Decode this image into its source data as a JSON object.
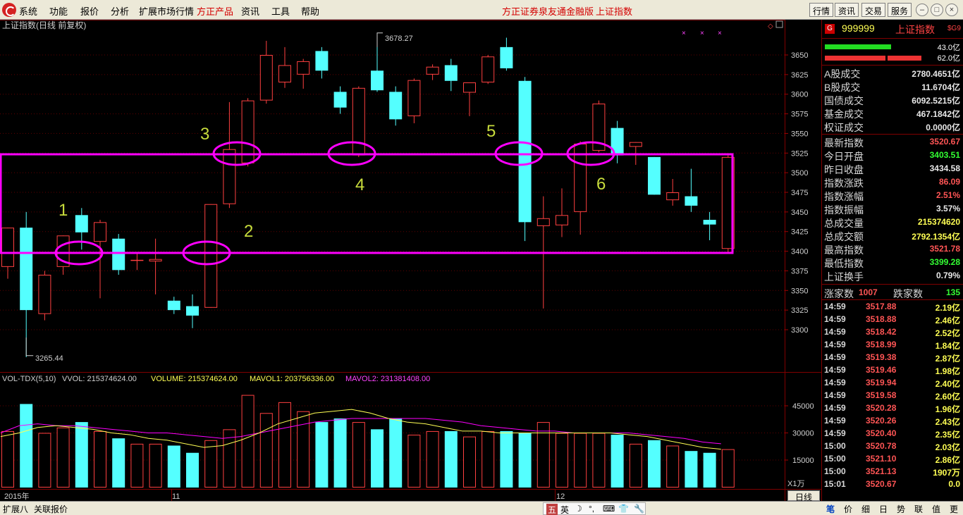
{
  "menu": {
    "items": [
      "系统",
      "功能",
      "报价",
      "分析",
      "扩展市场行情",
      "方正产品",
      "资讯",
      "工具",
      "帮助"
    ],
    "brand": "方正证券泉友通金融版",
    "brand_index": "上证指数",
    "right_buttons": [
      "行情",
      "资讯",
      "交易",
      "服务"
    ]
  },
  "chart": {
    "title": "上证指数(日线 前复权)",
    "price_ticks": [
      "3650",
      "3625",
      "3600",
      "3575",
      "3550",
      "3525",
      "3500",
      "3475",
      "3450",
      "3425",
      "3400",
      "3375",
      "3350",
      "3325",
      "3300"
    ],
    "vol_ticks": [
      "45000",
      "30000",
      "15000"
    ],
    "vol_unit": "X1万",
    "high_label": "3678.27",
    "low_label": "3265.44",
    "date_labels": [
      "2015年",
      "11",
      "12"
    ],
    "annotations": [
      "1",
      "2",
      "3",
      "4",
      "5",
      "6"
    ],
    "volume_header": {
      "name": "VOL-TDX(5,10)",
      "vvol": "VVOL: 215374624.00",
      "volume": "VOLUME: 215374624.00",
      "mavol1": "MAVOL1: 203756336.00",
      "mavol2": "MAVOL2: 231381408.00"
    },
    "period": "日线"
  },
  "chart_data": {
    "type": "candlestick",
    "title": "上证指数(日线 前复权)",
    "ylim": [
      3265,
      3690
    ],
    "candles": [
      {
        "o": 3380,
        "h": 3405,
        "c": 3430,
        "l": 3365
      },
      {
        "o": 3430,
        "h": 3450,
        "c": 3325,
        "l": 3265
      },
      {
        "o": 3320,
        "h": 3375,
        "c": 3370,
        "l": 3312
      },
      {
        "o": 3380,
        "h": 3415,
        "c": 3420,
        "l": 3370
      },
      {
        "o": 3446,
        "h": 3455,
        "c": 3424,
        "l": 3402
      },
      {
        "o": 3412,
        "h": 3440,
        "c": 3437,
        "l": 3340
      },
      {
        "o": 3416,
        "h": 3422,
        "c": 3376,
        "l": 3370
      },
      {
        "o": 3389,
        "h": 3398,
        "c": 3389,
        "l": 3376
      },
      {
        "o": 3387,
        "h": 3416,
        "c": 3390,
        "l": 3345
      },
      {
        "o": 3337,
        "h": 3342,
        "c": 3325,
        "l": 3320
      },
      {
        "o": 3330,
        "h": 3345,
        "c": 3318,
        "l": 3302
      },
      {
        "o": 3328,
        "h": 3460,
        "c": 3460,
        "l": 3328
      },
      {
        "o": 3460,
        "h": 3590,
        "c": 3530,
        "l": 3455
      },
      {
        "o": 3512,
        "h": 3595,
        "c": 3592,
        "l": 3508
      },
      {
        "o": 3592,
        "h": 3668,
        "c": 3650,
        "l": 3588
      },
      {
        "o": 3615,
        "h": 3660,
        "c": 3637,
        "l": 3608
      },
      {
        "o": 3625,
        "h": 3645,
        "c": 3642,
        "l": 3607
      },
      {
        "o": 3655,
        "h": 3660,
        "c": 3630,
        "l": 3620
      },
      {
        "o": 3603,
        "h": 3610,
        "c": 3583,
        "l": 3575
      },
      {
        "o": 3522,
        "h": 3610,
        "c": 3608,
        "l": 3520
      },
      {
        "o": 3630,
        "h": 3678,
        "c": 3605,
        "l": 3603
      },
      {
        "o": 3603,
        "h": 3610,
        "c": 3568,
        "l": 3560
      },
      {
        "o": 3572,
        "h": 3620,
        "c": 3618,
        "l": 3563
      },
      {
        "o": 3625,
        "h": 3638,
        "c": 3635,
        "l": 3618
      },
      {
        "o": 3637,
        "h": 3645,
        "c": 3617,
        "l": 3604
      },
      {
        "o": 3602,
        "h": 3615,
        "c": 3615,
        "l": 3572
      },
      {
        "o": 3615,
        "h": 3650,
        "c": 3648,
        "l": 3613
      },
      {
        "o": 3660,
        "h": 3672,
        "c": 3633,
        "l": 3630
      },
      {
        "o": 3617,
        "h": 3622,
        "c": 3437,
        "l": 3413
      },
      {
        "o": 3432,
        "h": 3470,
        "c": 3442,
        "l": 3327
      },
      {
        "o": 3433,
        "h": 3480,
        "c": 3446,
        "l": 3418
      },
      {
        "o": 3450,
        "h": 3540,
        "c": 3537,
        "l": 3421
      },
      {
        "o": 3528,
        "h": 3592,
        "c": 3588,
        "l": 3526
      },
      {
        "o": 3557,
        "h": 3566,
        "c": 3522,
        "l": 3512
      },
      {
        "o": 3533,
        "h": 3538,
        "c": 3539,
        "l": 3510
      },
      {
        "o": 3520,
        "h": 3520,
        "c": 3472,
        "l": 3472
      },
      {
        "o": 3465,
        "h": 3492,
        "c": 3475,
        "l": 3458
      },
      {
        "o": 3470,
        "h": 3505,
        "c": 3458,
        "l": 3450
      },
      {
        "o": 3440,
        "h": 3450,
        "c": 3434,
        "l": 3414
      },
      {
        "o": 3403,
        "h": 3522,
        "c": 3520,
        "l": 3399
      }
    ],
    "volume": [
      31,
      46,
      30,
      33,
      36,
      31,
      27,
      24,
      24,
      23,
      19,
      26,
      32,
      51,
      41,
      47,
      42,
      36,
      38,
      36,
      32,
      38,
      29,
      31,
      31,
      28,
      31,
      31,
      30,
      36,
      30,
      30,
      30,
      29,
      24,
      26,
      23,
      20,
      19,
      21
    ],
    "mavol1_y": [
      28,
      30,
      33,
      34,
      33,
      32,
      30,
      29,
      27,
      26,
      24,
      22,
      23,
      26,
      30,
      35,
      38,
      41,
      42,
      43,
      41,
      38,
      36,
      35,
      33,
      31,
      31,
      30,
      30,
      30,
      30,
      30,
      30,
      30,
      29,
      28,
      26,
      24,
      22,
      21
    ],
    "mavol2_y": [
      30,
      34,
      35,
      34,
      34,
      33,
      32,
      31,
      30,
      30,
      29,
      28,
      27,
      28,
      30,
      32,
      34,
      36,
      37,
      38,
      38,
      38,
      38,
      38,
      37,
      36,
      34,
      33,
      32,
      31,
      31,
      30,
      30,
      30,
      30,
      29,
      28,
      27,
      25,
      24
    ]
  },
  "panel": {
    "badge": "G",
    "code": "999999",
    "name": "上证指数",
    "tag": "$G9",
    "bar1": "43.0亿",
    "bar2": "62.0亿",
    "rows_a": [
      {
        "label": "A股成交",
        "value": "2780.4651亿",
        "color": "white"
      },
      {
        "label": "B股成交",
        "value": "11.6704亿",
        "color": "white"
      },
      {
        "label": "国债成交",
        "value": "6092.5215亿",
        "color": "white"
      },
      {
        "label": "基金成交",
        "value": "467.1842亿",
        "color": "white"
      },
      {
        "label": "权证成交",
        "value": "0.0000亿",
        "color": "white"
      }
    ],
    "rows_b": [
      {
        "label": "最新指数",
        "value": "3520.67",
        "color": "red"
      },
      {
        "label": "今日开盘",
        "value": "3403.51",
        "color": "green"
      },
      {
        "label": "昨日收盘",
        "value": "3434.58",
        "color": "white"
      },
      {
        "label": "指数涨跌",
        "value": "86.09",
        "color": "red"
      },
      {
        "label": "指数涨幅",
        "value": "2.51%",
        "color": "red"
      },
      {
        "label": "指数振幅",
        "value": "3.57%",
        "color": "white"
      },
      {
        "label": "总成交量",
        "value": "215374620",
        "color": "yellow"
      },
      {
        "label": "总成交额",
        "value": "2792.1354亿",
        "color": "yellow"
      },
      {
        "label": "最高指数",
        "value": "3521.78",
        "color": "red"
      },
      {
        "label": "最低指数",
        "value": "3399.28",
        "color": "green"
      },
      {
        "label": "上证换手",
        "value": "0.79%",
        "color": "white"
      }
    ],
    "updown": {
      "up_label": "涨家数",
      "up": "1007",
      "down_label": "跌家数",
      "down": "135"
    },
    "ticks": [
      {
        "t": "14:59",
        "p": "3517.88",
        "q": "2.19亿"
      },
      {
        "t": "14:59",
        "p": "3518.88",
        "q": "2.46亿"
      },
      {
        "t": "14:59",
        "p": "3518.42",
        "q": "2.52亿"
      },
      {
        "t": "14:59",
        "p": "3518.99",
        "q": "1.84亿"
      },
      {
        "t": "14:59",
        "p": "3519.38",
        "q": "2.87亿"
      },
      {
        "t": "14:59",
        "p": "3519.46",
        "q": "1.98亿"
      },
      {
        "t": "14:59",
        "p": "3519.94",
        "q": "2.40亿"
      },
      {
        "t": "14:59",
        "p": "3519.58",
        "q": "2.60亿"
      },
      {
        "t": "14:59",
        "p": "3520.28",
        "q": "1.96亿"
      },
      {
        "t": "14:59",
        "p": "3520.26",
        "q": "2.43亿"
      },
      {
        "t": "14:59",
        "p": "3520.40",
        "q": "2.35亿"
      },
      {
        "t": "15:00",
        "p": "3520.78",
        "q": "2.03亿"
      },
      {
        "t": "15:00",
        "p": "3521.10",
        "q": "2.86亿"
      },
      {
        "t": "15:00",
        "p": "3521.13",
        "q": "1907万"
      },
      {
        "t": "15:01",
        "p": "3520.67",
        "q": "0.0"
      }
    ],
    "tabs": [
      "笔",
      "价",
      "细",
      "日",
      "势",
      "联",
      "值",
      "更"
    ]
  },
  "status": {
    "left1": "扩展八",
    "left2": "关联报价",
    "ime": [
      "五",
      "英",
      "☽",
      "°,",
      "⌨",
      "👕",
      "🔧"
    ]
  },
  "colors": {
    "up": "#ff4040",
    "down": "#54ffff",
    "highlight": "#ff00ff",
    "annotation": "#c8dc3c",
    "mavol1": "#ffff54",
    "mavol2": "#ff00ff"
  }
}
